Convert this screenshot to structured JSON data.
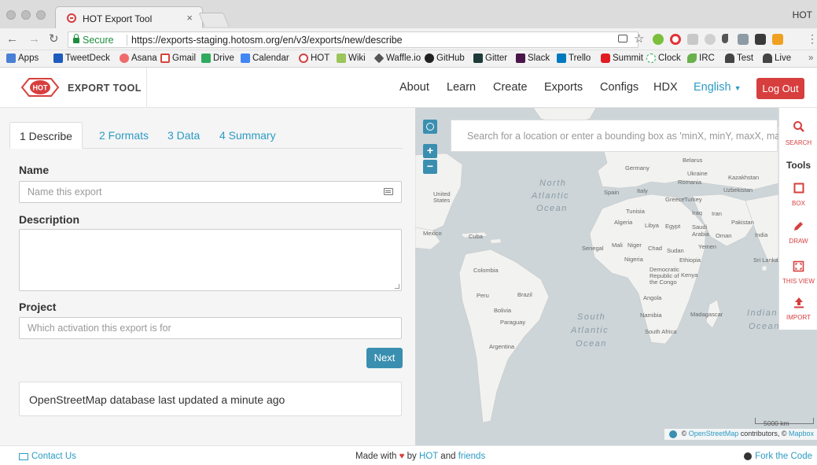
{
  "browser": {
    "tab_title": "HOT Export Tool",
    "tab_close": "×",
    "profile": "HOT",
    "secure_label": "Secure",
    "url": "https://exports-staging.hotosm.org/en/v3/exports/new/describe",
    "bookmarks": [
      "Apps",
      "TweetDeck",
      "Asana",
      "Gmail",
      "Drive",
      "Calendar",
      "HOT",
      "Wiki",
      "Waffle.io",
      "GitHub",
      "Gitter",
      "Slack",
      "Trello",
      "Summit",
      "Clock",
      "IRC",
      "Test",
      "Live"
    ],
    "bookmarks_more": "»"
  },
  "navbar": {
    "brand_logo_text": "HOT",
    "brand_text": "EXPORT TOOL",
    "links": [
      "About",
      "Learn",
      "Create",
      "Exports",
      "Configs",
      "HDX"
    ],
    "language": "English",
    "logout": "Log Out"
  },
  "form": {
    "tabs": [
      "1 Describe",
      "2 Formats",
      "3 Data",
      "4 Summary"
    ],
    "name_label": "Name",
    "name_placeholder": "Name this export",
    "description_label": "Description",
    "project_label": "Project",
    "project_placeholder": "Which activation this export is for",
    "next_label": "Next",
    "osm_status": "OpenStreetMap database last updated a minute ago"
  },
  "map": {
    "search_placeholder": "Search for a location or enter a bounding box as 'minX, minY, maxX, maxY'",
    "tools_title": "Tools",
    "tools": [
      {
        "label": "SEARCH",
        "icon": "search-icon"
      },
      {
        "label": "BOX",
        "icon": "box-icon"
      },
      {
        "label": "DRAW",
        "icon": "pencil-icon"
      },
      {
        "label": "THIS VIEW",
        "icon": "expand-icon"
      },
      {
        "label": "IMPORT",
        "icon": "upload-icon"
      }
    ],
    "zoom_in": "+",
    "zoom_out": "−",
    "scale": "5000 km",
    "attribution_prefix": "©",
    "attribution_osm": "OpenStreetMap",
    "attribution_mid": "contributors, ©",
    "attribution_mapbox": "Mapbox",
    "oceans": {
      "north_atlantic": [
        "North",
        "Atlantic",
        "Ocean"
      ],
      "south_atlantic": [
        "South",
        "Atlantic",
        "Ocean"
      ],
      "indian": [
        "Indian",
        "Ocean"
      ]
    },
    "places": {
      "united_states": "United States",
      "mexico": "Mexico",
      "cuba": "Cuba",
      "colombia": "Colombia",
      "peru": "Peru",
      "brazil": "Brazil",
      "bolivia": "Bolivia",
      "paraguay": "Paraguay",
      "argentina": "Argentina",
      "germany": "Germany",
      "belarus": "Belarus",
      "ukraine": "Ukraine",
      "kazakhstan": "Kazakhstan",
      "romania": "Romania",
      "uzbekistan": "Uzbekistan",
      "spain": "Spain",
      "italy": "Italy",
      "greece": "Greece",
      "turkey": "Turkey",
      "tunisia": "Tunisia",
      "iraq": "Iraq",
      "iran": "Iran",
      "algeria": "Algeria",
      "libya": "Libya",
      "egypt": "Egypt",
      "saudi_arabia": "Saudi Arabia",
      "pakistan": "Pakistan",
      "oman": "Oman",
      "india": "India",
      "yemen": "Yemen",
      "senegal": "Senegal",
      "mali": "Mali",
      "niger": "Niger",
      "chad": "Chad",
      "sudan": "Sudan",
      "nigeria": "Nigeria",
      "ethiopia": "Ethiopia",
      "sri_lanka": "Sri Lanka",
      "drc": "Democratic Republic of the Congo",
      "kenya": "Kenya",
      "angola": "Angola",
      "namibia": "Namibia",
      "madagascar": "Madagascar",
      "south_africa": "South Africa"
    }
  },
  "footer": {
    "contact": "Contact Us",
    "made_with": "Made with",
    "by": "by",
    "hot": "HOT",
    "and": "and",
    "friends": "friends",
    "fork": "Fork the Code"
  },
  "colors": {
    "brand_red": "#d73f3f",
    "accent_blue": "#2c9bc4",
    "button_blue": "#3a8fb0"
  }
}
